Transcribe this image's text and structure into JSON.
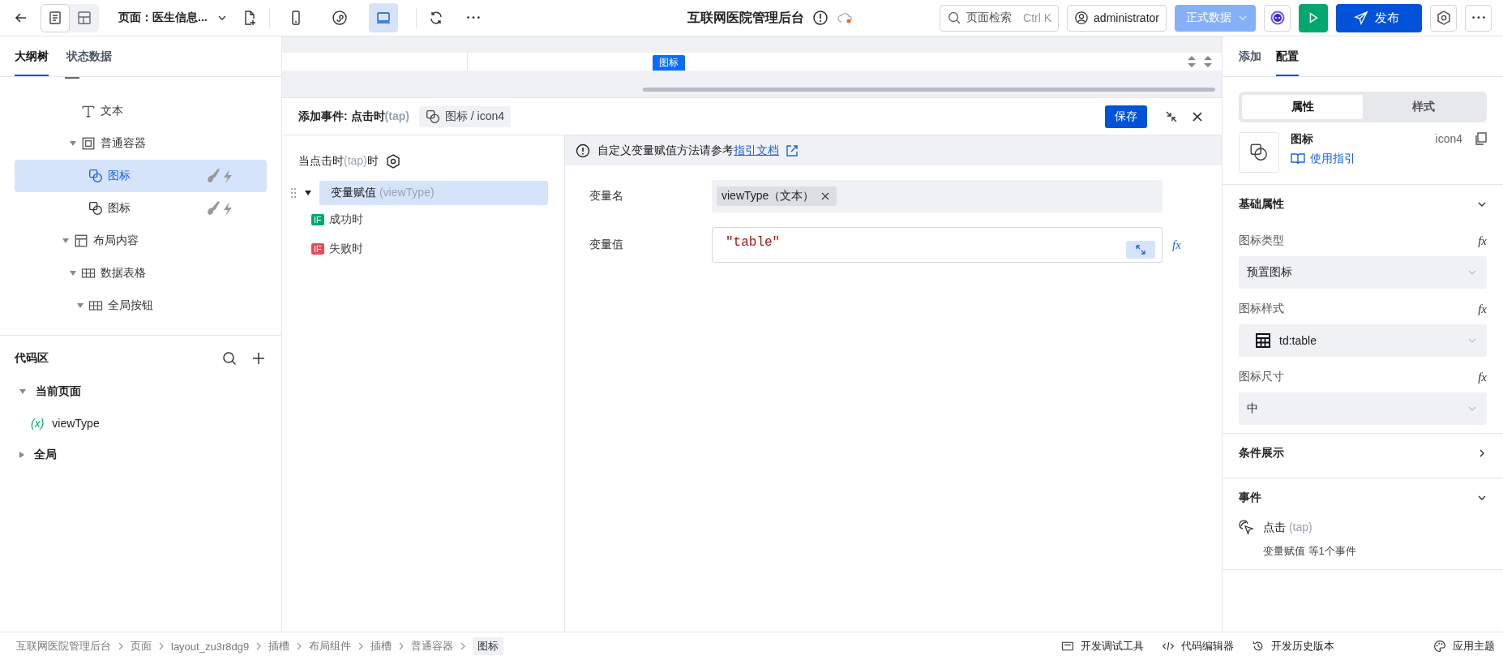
{
  "toolbar": {
    "view_toggles": [
      {
        "kind": "page",
        "selected": true
      },
      {
        "kind": "layout",
        "selected": false
      }
    ],
    "page_label": "页面：医生信息...",
    "devices": [
      {
        "kind": "mobile",
        "selected": false
      },
      {
        "kind": "miniapp",
        "selected": false
      },
      {
        "kind": "desktop",
        "selected": true
      }
    ],
    "title": "互联网医院管理后台",
    "search": {
      "placeholder": "页面检索",
      "shortcut": "Ctrl K"
    },
    "user": "administrator",
    "data_mode": "正式数据",
    "publish": "发布"
  },
  "left_tabs": [
    {
      "label": "大纲树",
      "selected": true
    },
    {
      "label": "状态数据",
      "selected": false
    }
  ],
  "outline": {
    "nested_items": [
      {
        "label": "文本",
        "kind": "text",
        "selected": false
      },
      {
        "label": "普通容器",
        "kind": "container",
        "selected": false,
        "expanded": true,
        "children": [
          {
            "label": "图标",
            "kind": "shape",
            "selected": true,
            "actions": true
          },
          {
            "label": "图标",
            "kind": "shape",
            "selected": false,
            "actions": true
          }
        ]
      }
    ],
    "items": [
      {
        "label": "布局内容",
        "kind": "layout",
        "selected": false,
        "expanded": true,
        "children": [
          {
            "label": "数据表格",
            "kind": "grid",
            "selected": false,
            "expanded": true,
            "children": [
              {
                "label": "全局按钮",
                "kind": "grid",
                "selected": false,
                "expanded": true
              }
            ]
          }
        ]
      }
    ]
  },
  "code_area": {
    "title": "代码区",
    "groups": [
      {
        "label": "当前页面",
        "expanded": true,
        "children": [
          {
            "label": "viewType",
            "symbol": "(x)"
          }
        ]
      },
      {
        "label": "全局",
        "expanded": false
      }
    ]
  },
  "canvas": {
    "badge": "图标"
  },
  "event_editor": {
    "title": "添加事件: 点击时",
    "title_hint": "(tap)",
    "target": "图标 / icon4",
    "save": "保存",
    "trigger": {
      "before": "当点击时",
      "hint": "(tap)",
      "after": "时"
    },
    "actions": [
      {
        "label": "变量赋值",
        "hint": "(viewType)",
        "selected": true,
        "expanded": true,
        "children": [
          {
            "kind": "success",
            "badge": "IF",
            "label": "成功时"
          },
          {
            "kind": "fail",
            "badge": "IF",
            "label": "失败时"
          }
        ]
      }
    ],
    "notice": {
      "text": "自定义变量赋值方法请参考",
      "link": "指引文档"
    },
    "fields": [
      {
        "label": "变量名",
        "kind": "tag",
        "value": "viewType（文本）"
      },
      {
        "label": "变量值",
        "kind": "code",
        "value": "\"table\"",
        "formula": "fx"
      }
    ]
  },
  "right_tabs": [
    {
      "label": "添加",
      "selected": false
    },
    {
      "label": "配置",
      "selected": true
    }
  ],
  "segments": [
    {
      "label": "属性",
      "selected": true
    },
    {
      "label": "样式",
      "selected": false
    }
  ],
  "component_card": {
    "name": "图标",
    "id": "icon4",
    "guide": "使用指引"
  },
  "sections": [
    {
      "title": "基础属性",
      "expanded": true,
      "props": [
        {
          "label": "图标类型",
          "formula": "fx",
          "value": "预置图标",
          "icon": false
        },
        {
          "label": "图标样式",
          "formula": "fx",
          "value": "td:table",
          "icon": true
        },
        {
          "label": "图标尺寸",
          "formula": "fx",
          "value": "中",
          "icon": false
        }
      ]
    },
    {
      "title": "条件展示",
      "expanded": false
    },
    {
      "title": "事件",
      "expanded": true,
      "events": [
        {
          "label": "点击",
          "hint": "(tap)",
          "summary": "变量赋值 等1个事件"
        }
      ]
    }
  ],
  "breadcrumbs": [
    "互联网医院管理后台",
    "页面",
    "layout_zu3r8dg9",
    "插槽",
    "布局组件",
    "插槽",
    "普通容器",
    "图标"
  ],
  "status_tools": [
    {
      "kind": "debug",
      "label": "开发调试工具"
    },
    {
      "kind": "code",
      "label": "代码编辑器"
    },
    {
      "kind": "history",
      "label": "开发历史版本"
    },
    {
      "kind": "theme",
      "label": "应用主题"
    }
  ]
}
